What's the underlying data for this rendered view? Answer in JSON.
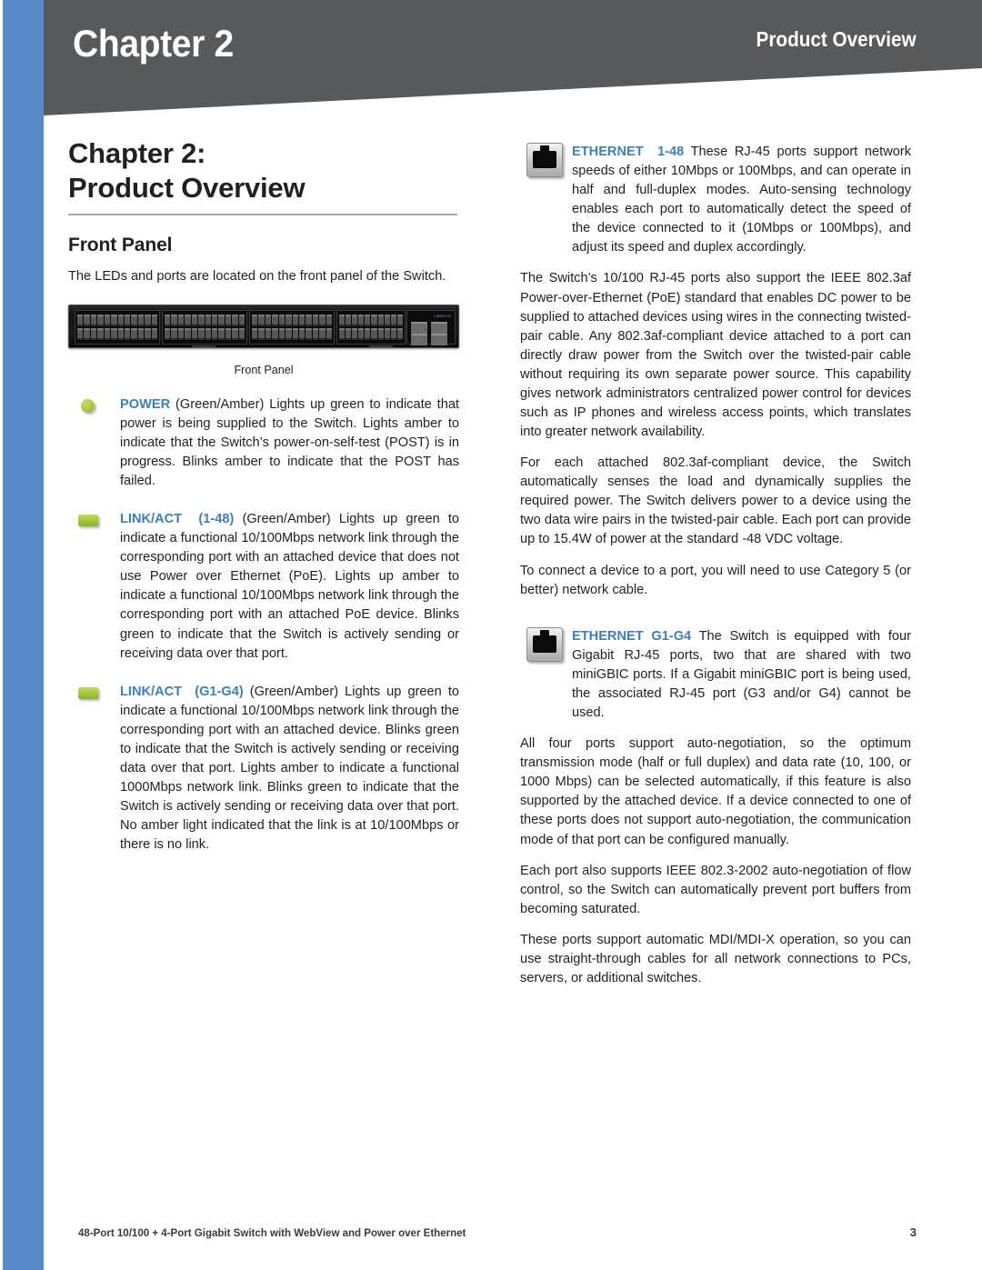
{
  "header": {
    "chapter_label": "Chapter 2",
    "section_label": "Product Overview",
    "band_color": "#58595b",
    "accent_color": "#5689c6"
  },
  "left_column": {
    "chapter_title_line1": "Chapter 2:",
    "chapter_title_line2": "Product Overview",
    "section_heading": "Front Panel",
    "intro_paragraph": "The LEDs and ports are located on the front panel of the Switch.",
    "figure": {
      "caption": "Front Panel",
      "alt_name": "48-port-switch-front-panel"
    },
    "led_items": [
      {
        "icon": "green-round-led-icon",
        "label": "POWER",
        "label_suffix": "",
        "text": " (Green/Amber) Lights up green to indicate that power is being supplied to the Switch. Lights amber to indicate that the Switch’s power-on-self-test (POST) is in progress. Blinks amber to indicate that the POST has failed."
      },
      {
        "icon": "green-bar-led-icon",
        "label": "LINK/ACT",
        "label_suffix": "(1-48)",
        "text": " (Green/Amber) Lights up green to indicate a functional 10/100Mbps network link through the corresponding port with an attached device that does not use Power over Ethernet (PoE). Lights up amber to indicate a functional 10/100Mbps network link through the corresponding port with an attached PoE device. Blinks green to indicate that the Switch is actively sending or receiving data over that port."
      },
      {
        "icon": "green-bar-led-icon",
        "label": "LINK/ACT",
        "label_suffix": "(G1-G4)",
        "text": " (Green/Amber) Lights up green to indicate a functional 10/100Mbps network link through the corresponding port with an attached device. Blinks green to indicate that the Switch is actively sending or receiving data over that port. Lights amber to indicate a functional 1000Mbps network link. Blinks green to indicate that the Switch is actively sending or receiving data over that port. No amber light indicated that the link is at 10/100Mbps or there is no link."
      }
    ]
  },
  "right_column": {
    "port_sections": [
      {
        "icon": "rj45-port-icon",
        "label": "ETHERNET",
        "label_suffix": "1-48",
        "lead_text": " These RJ-45 ports support network speeds of either 10Mbps or 100Mbps, and can operate in half and full-duplex modes. Auto-sensing technology enables each port to automatically detect the speed of the device connected to it (10Mbps or 100Mbps), and adjust its speed and duplex accordingly.",
        "paragraphs": [
          "The Switch’s 10/100 RJ-45 ports also support the IEEE 802.3af Power-over-Ethernet (PoE) standard that enables DC power to be supplied to attached devices using wires in the connecting twisted-pair cable. Any 802.3af-compliant device attached to a port can directly draw power from the Switch over the twisted-pair cable without requiring its own separate power source. This capability gives network administrators centralized power control for devices such as IP phones and wireless access points, which translates into greater network availability.",
          "For each attached 802.3af-compliant device, the Switch automatically senses the load and dynamically supplies the required power. The Switch delivers power to a device using the two data wire pairs in the twisted-pair cable. Each port can provide up to 15.4W of power at the standard -48 VDC voltage.",
          "To connect a device to a port, you will need to use Category 5 (or better) network cable."
        ]
      },
      {
        "icon": "rj45-port-icon",
        "label": "ETHERNET G1-G4",
        "label_suffix": "",
        "lead_text": "  The Switch is equipped with four Gigabit RJ-45 ports, two that are shared with two miniGBIC ports. If a Gigabit miniGBIC port is being used, the associated RJ-45 port (G3 and/or G4) cannot be used.",
        "paragraphs": [
          "All four ports support auto-negotiation, so the optimum transmission mode (half or full duplex) and data rate (10, 100, or 1000 Mbps) can be selected automatically, if this feature is also supported by the attached device. If a device connected to one of these ports does not support auto-negotiation, the communication mode of that port can be configured manually.",
          "Each port also supports IEEE 802.3-2002 auto-negotiation of flow control, so the Switch can automatically prevent port buffers from becoming saturated.",
          "These ports support automatic MDI/MDI-X operation, so you can use straight-through cables for all network connections to PCs, servers, or additional switches."
        ]
      }
    ]
  },
  "footer": {
    "text": "48-Port 10/100 + 4-Port Gigabit Switch with WebView and Power over Ethernet",
    "page_number": "3"
  }
}
